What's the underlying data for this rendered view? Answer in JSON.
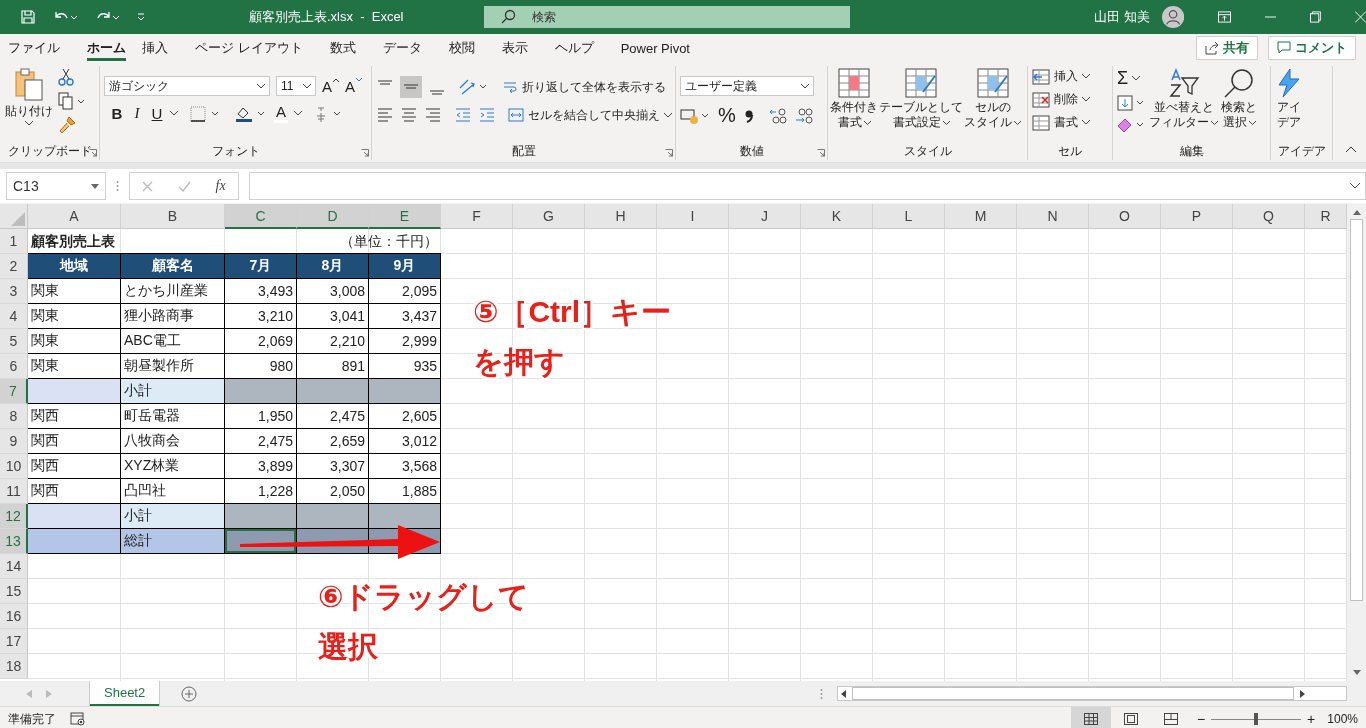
{
  "title_bar": {
    "title": "顧客別売上表.xlsx  -  Excel",
    "search": {
      "placeholder": "検索"
    },
    "user": "山田 知美"
  },
  "menu_tabs": [
    {
      "label": "ファイル",
      "selected": false
    },
    {
      "label": "ホーム",
      "selected": true
    },
    {
      "label": "挿入",
      "selected": false
    },
    {
      "label": "ページ レイアウト",
      "selected": false
    },
    {
      "label": "数式",
      "selected": false
    },
    {
      "label": "データ",
      "selected": false
    },
    {
      "label": "校閲",
      "selected": false
    },
    {
      "label": "表示",
      "selected": false
    },
    {
      "label": "ヘルプ",
      "selected": false
    },
    {
      "label": "Power Pivot",
      "selected": false
    }
  ],
  "share_button": "共有",
  "comment_button": "コメント",
  "ribbon": {
    "groups": [
      {
        "kind": "clipboard",
        "label": "クリップボード",
        "paste": "貼り付け"
      },
      {
        "kind": "font",
        "label": "フォント",
        "font_name": "游ゴシック",
        "font_size": "11",
        "grow": "A",
        "shrink": "A",
        "bold": "B",
        "italic": "I",
        "underline": "U",
        "font_color": "A"
      },
      {
        "kind": "alignment",
        "label": "配置",
        "wrap_text": "折り返して全体を表示する",
        "merge": "セルを結合して中央揃え"
      },
      {
        "kind": "number",
        "label": "数値",
        "format": "ユーザー定義",
        "percent": "%"
      },
      {
        "kind": "styles",
        "label": "スタイル",
        "buttons": [
          {
            "lines": [
              "条件付き",
              "書式"
            ]
          },
          {
            "lines": [
              "テーブルとして",
              "書式設定"
            ]
          },
          {
            "lines": [
              "セルの",
              "スタイル"
            ]
          }
        ]
      },
      {
        "kind": "cells",
        "label": "セル",
        "buttons": [
          "挿入",
          "削除",
          "書式"
        ]
      },
      {
        "kind": "editing",
        "label": "編集",
        "sum": "Σ",
        "buttons": [
          {
            "lines": [
              "並べ替えと",
              "フィルター"
            ]
          },
          {
            "lines": [
              "検索と",
              "選択"
            ]
          }
        ]
      },
      {
        "kind": "ideas",
        "label": "アイデア",
        "buttons": [
          {
            "lines": [
              "アイ",
              "デア"
            ]
          }
        ]
      }
    ]
  },
  "formula_bar": {
    "name_box": "C13",
    "fx": "fx"
  },
  "columns": [
    {
      "label": "A",
      "selected": false
    },
    {
      "label": "B",
      "selected": false
    },
    {
      "label": "C",
      "selected": true
    },
    {
      "label": "D",
      "selected": true
    },
    {
      "label": "E",
      "selected": true
    },
    {
      "label": "F",
      "selected": false
    },
    {
      "label": "G",
      "selected": false
    },
    {
      "label": "H",
      "selected": false
    },
    {
      "label": "I",
      "selected": false
    },
    {
      "label": "J",
      "selected": false
    },
    {
      "label": "K",
      "selected": false
    },
    {
      "label": "L",
      "selected": false
    },
    {
      "label": "M",
      "selected": false
    },
    {
      "label": "N",
      "selected": false
    },
    {
      "label": "O",
      "selected": false
    },
    {
      "label": "P",
      "selected": false
    },
    {
      "label": "Q",
      "selected": false
    },
    {
      "label": "R",
      "selected": false
    }
  ],
  "rows": [
    {
      "number": "1",
      "kind": "title",
      "selected": false,
      "cells": [
        {
          "text": "顧客別売上表"
        },
        {},
        {},
        {},
        {
          "text": "（単位：千円）"
        }
      ]
    },
    {
      "number": "2",
      "kind": "header",
      "selected": false,
      "cells": [
        {
          "text": "地域",
          "selected": false
        },
        {
          "text": "顧客名",
          "selected": false
        },
        {
          "text": "7月",
          "selected": false
        },
        {
          "text": "8月",
          "selected": false
        },
        {
          "text": "9月",
          "selected": false
        }
      ]
    },
    {
      "number": "3",
      "kind": "data",
      "selected": false,
      "cells": [
        {
          "text": "関東",
          "selected": false
        },
        {
          "text": "とかち川産業",
          "selected": false
        },
        {
          "text": "3,493",
          "selected": false
        },
        {
          "text": "3,008",
          "selected": false
        },
        {
          "text": "2,095",
          "selected": false
        }
      ]
    },
    {
      "number": "4",
      "kind": "data",
      "selected": false,
      "cells": [
        {
          "text": "関東",
          "selected": false
        },
        {
          "text": "狸小路商事",
          "selected": false
        },
        {
          "text": "3,210",
          "selected": false
        },
        {
          "text": "3,041",
          "selected": false
        },
        {
          "text": "3,437",
          "selected": false
        }
      ]
    },
    {
      "number": "5",
      "kind": "data",
      "selected": false,
      "cells": [
        {
          "text": "関東",
          "selected": false
        },
        {
          "text": "ABC電工",
          "selected": false
        },
        {
          "text": "2,069",
          "selected": false
        },
        {
          "text": "2,210",
          "selected": false
        },
        {
          "text": "2,999",
          "selected": false
        }
      ]
    },
    {
      "number": "6",
      "kind": "data",
      "selected": false,
      "cells": [
        {
          "text": "関東",
          "selected": false
        },
        {
          "text": "朝昼製作所",
          "selected": false
        },
        {
          "text": "980",
          "selected": false
        },
        {
          "text": "891",
          "selected": false
        },
        {
          "text": "935",
          "selected": false
        }
      ]
    },
    {
      "number": "7",
      "kind": "subtotal",
      "selected": true,
      "cells": [
        {
          "selected": false
        },
        {
          "text": "小計",
          "selected": false
        },
        {
          "selected": true
        },
        {
          "selected": true
        },
        {
          "selected": true
        }
      ]
    },
    {
      "number": "8",
      "kind": "data",
      "selected": false,
      "cells": [
        {
          "text": "関西",
          "selected": false
        },
        {
          "text": "町岳電器",
          "selected": false
        },
        {
          "text": "1,950",
          "selected": false
        },
        {
          "text": "2,475",
          "selected": false
        },
        {
          "text": "2,605",
          "selected": false
        }
      ]
    },
    {
      "number": "9",
      "kind": "data",
      "selected": false,
      "cells": [
        {
          "text": "関西",
          "selected": false
        },
        {
          "text": "八牧商会",
          "selected": false
        },
        {
          "text": "2,475",
          "selected": false
        },
        {
          "text": "2,659",
          "selected": false
        },
        {
          "text": "3,012",
          "selected": false
        }
      ]
    },
    {
      "number": "10",
      "kind": "data",
      "selected": false,
      "cells": [
        {
          "text": "関西",
          "selected": false
        },
        {
          "text": "XYZ林業",
          "selected": false
        },
        {
          "text": "3,899",
          "selected": false
        },
        {
          "text": "3,307",
          "selected": false
        },
        {
          "text": "3,568",
          "selected": false
        }
      ]
    },
    {
      "number": "11",
      "kind": "data",
      "selected": false,
      "cells": [
        {
          "text": "関西",
          "selected": false
        },
        {
          "text": "凸凹社",
          "selected": false
        },
        {
          "text": "1,228",
          "selected": false
        },
        {
          "text": "2,050",
          "selected": false
        },
        {
          "text": "1,885",
          "selected": false
        }
      ]
    },
    {
      "number": "12",
      "kind": "subtotal",
      "selected": true,
      "cells": [
        {
          "selected": false
        },
        {
          "text": "小計",
          "selected": false
        },
        {
          "selected": true
        },
        {
          "selected": true
        },
        {
          "selected": true
        }
      ]
    },
    {
      "number": "13",
      "kind": "total",
      "selected": true,
      "cells": [
        {
          "selected": false
        },
        {
          "text": "総計",
          "selected": false
        },
        {
          "selected": true,
          "active": true
        },
        {
          "selected": true
        },
        {
          "selected": true
        }
      ]
    },
    {
      "number": "14",
      "kind": "empty",
      "selected": false
    },
    {
      "number": "15",
      "kind": "empty",
      "selected": false
    },
    {
      "number": "16",
      "kind": "empty",
      "selected": false
    },
    {
      "number": "17",
      "kind": "empty",
      "selected": false
    },
    {
      "number": "18",
      "kind": "empty",
      "selected": false
    }
  ],
  "annotations": [
    {
      "kind": "ctrl",
      "lines": [
        "⑤［Ctrl］キー",
        "を押す"
      ]
    },
    {
      "kind": "drag",
      "lines": [
        "⑥ドラッグして",
        "選択"
      ]
    }
  ],
  "sheet_tabs": [
    {
      "label": "Sheet2",
      "selected": true
    }
  ],
  "status_bar": {
    "status": "準備完了",
    "views": [
      {
        "kind": "normal",
        "selected": true
      },
      {
        "kind": "page_layout",
        "selected": false
      },
      {
        "kind": "page_break",
        "selected": false
      }
    ],
    "zoom_out": "−",
    "zoom_in": "+",
    "zoom": {
      "level": 0.5
    },
    "zoom_label": "100%"
  }
}
